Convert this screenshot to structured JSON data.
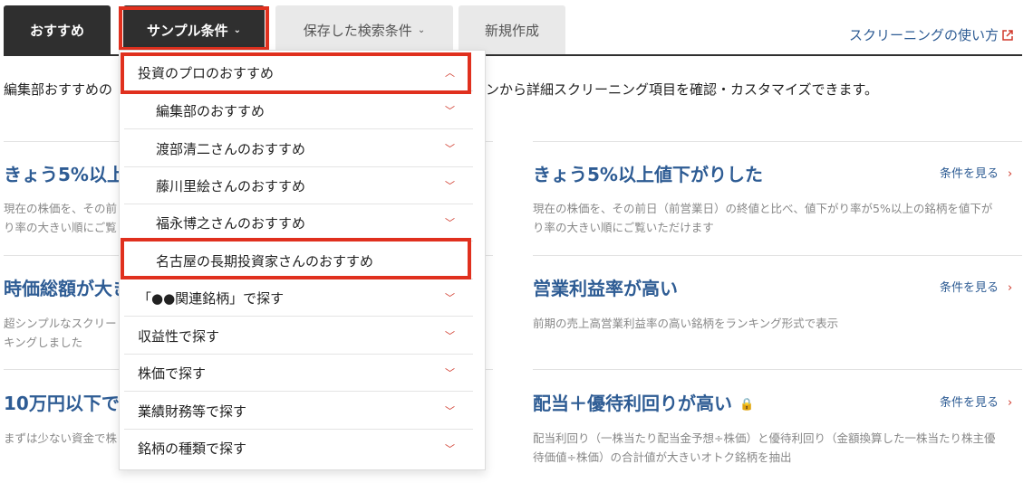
{
  "tabs": {
    "recommended": "おすすめ",
    "sample": "サンプル条件",
    "saved": "保存した検索条件",
    "new": "新規作成"
  },
  "howto_link": "スクリーニングの使い方",
  "intro": {
    "left": "編集部おすすめの",
    "right": "ンから詳細スクリーニング項目を確認・カスタマイズできます。"
  },
  "cards_left": [
    {
      "title": "きょう5%以上",
      "desc1": "現在の株価を、その前",
      "desc2": "り率の大きい順にご覧"
    },
    {
      "title": "時価総額が大き",
      "desc1": "超シンプルなスクリー",
      "desc2": "キングしました"
    },
    {
      "title": "10万円以下で",
      "desc1": "まずは少ない資金で株",
      "desc2": ""
    }
  ],
  "cards_right": [
    {
      "title": "きょう5%以上値下がりした",
      "desc1": "現在の株価を、その前日（前営業日）の終値と比べ、値下がり率が5%以上の銘柄を値下が",
      "desc2": "り率の大きい順にご覧いただけます",
      "link": "条件を見る"
    },
    {
      "title": "営業利益率が高い",
      "desc1": "前期の売上高営業利益率の高い銘柄をランキング形式で表示",
      "desc2": "",
      "link": "条件を見る"
    },
    {
      "title": "配当＋優待利回りが高い",
      "desc1": "配当利回り（一株当たり配当金予想÷株価）と優待利回り（金額換算した一株当たり株主優",
      "desc2": "待価値÷株価）の合計値が大きいオトク銘柄を抽出",
      "link": "条件を見る"
    }
  ],
  "dropdown": {
    "items": [
      {
        "label": "投資のプロのおすすめ",
        "icon": "chevron-up"
      },
      {
        "label": "編集部のおすすめ",
        "icon": "chevron-down"
      },
      {
        "label": "渡部清二さんのおすすめ",
        "icon": "chevron-down"
      },
      {
        "label": "藤川里絵さんのおすすめ",
        "icon": "chevron-down"
      },
      {
        "label": "福永博之さんのおすすめ",
        "icon": "chevron-down"
      },
      {
        "label": "名古屋の長期投資家さんのおすすめ",
        "icon": "chevron-down"
      },
      {
        "label": "「●●関連銘柄」で探す",
        "icon": "chevron-down"
      },
      {
        "label": "収益性で探す",
        "icon": "chevron-down"
      },
      {
        "label": "株価で探す",
        "icon": "chevron-down"
      },
      {
        "label": "業績財務等で探す",
        "icon": "chevron-down"
      },
      {
        "label": "銘柄の種類で探す",
        "icon": "chevron-down"
      }
    ]
  },
  "colors": {
    "accent": "#2e5c94",
    "highlight": "#e0301e",
    "dark_tab": "#2f2f2f"
  }
}
